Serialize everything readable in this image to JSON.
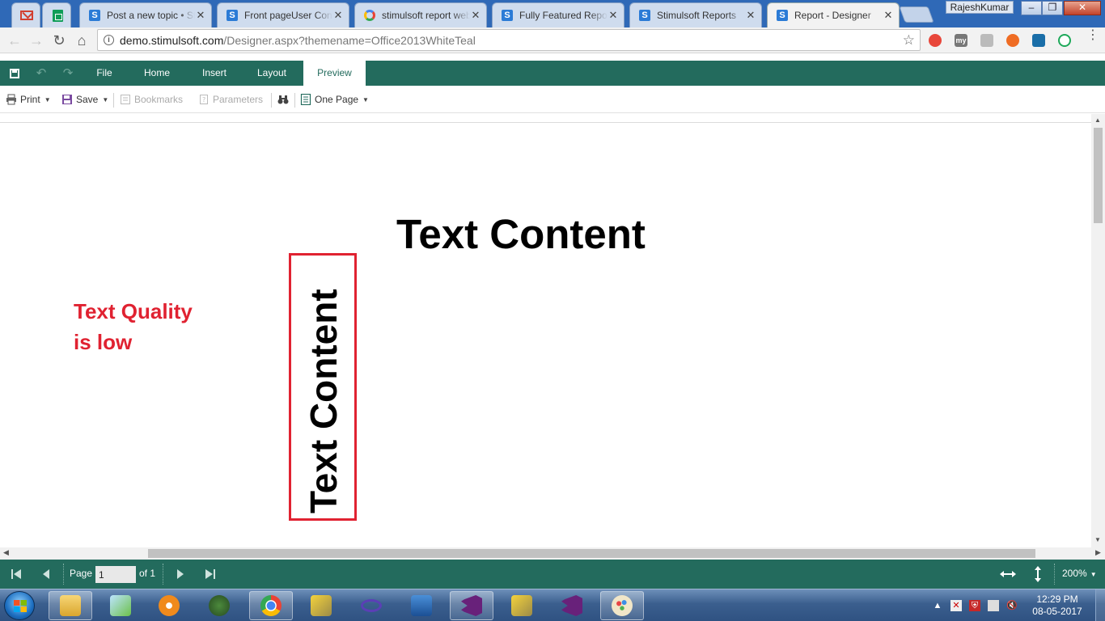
{
  "browser": {
    "tabs": [
      {
        "icon": "gmail-icon",
        "title": ""
      },
      {
        "icon": "sheets-icon",
        "title": ""
      },
      {
        "icon": "stimulsoft-icon",
        "title": "Post a new topic • Stimulsoft"
      },
      {
        "icon": "stimulsoft-icon",
        "title": "Front pageUser Control"
      },
      {
        "icon": "google-icon",
        "title": "stimulsoft report web"
      },
      {
        "icon": "stimulsoft-icon",
        "title": "Fully Featured Report"
      },
      {
        "icon": "stimulsoft-icon",
        "title": "Stimulsoft Reports"
      },
      {
        "icon": "stimulsoft-icon",
        "title": "Report - Designer"
      }
    ],
    "user": "RajeshKumar",
    "url_host": "demo.stimulsoft.com",
    "url_path": "/Designer.aspx?themename=Office2013WhiteTeal",
    "window_minimize": "–",
    "window_maximize": "❐",
    "window_close": "✕"
  },
  "designer": {
    "menu_tabs": [
      "File",
      "Home",
      "Insert",
      "Layout",
      "Preview"
    ],
    "active_tab": "Preview",
    "preview_toolbar": {
      "print": "Print",
      "save": "Save",
      "bookmarks": "Bookmarks",
      "parameters": "Parameters",
      "view_mode": "One Page"
    },
    "report": {
      "horizontal_text": "Text Content",
      "vertical_text": "Text Content",
      "annotation_line1": "Text Quality",
      "annotation_line2": "is low"
    },
    "statusbar": {
      "page_label": "Page",
      "page_value": "1",
      "page_of": "of 1",
      "zoom": "200%"
    }
  },
  "taskbar": {
    "time": "12:29 PM",
    "date": "08-05-2017"
  },
  "colors": {
    "accent_teal": "#236b5d",
    "annotation_red": "#e02231",
    "tab_strip_blue": "#2f69b7"
  }
}
